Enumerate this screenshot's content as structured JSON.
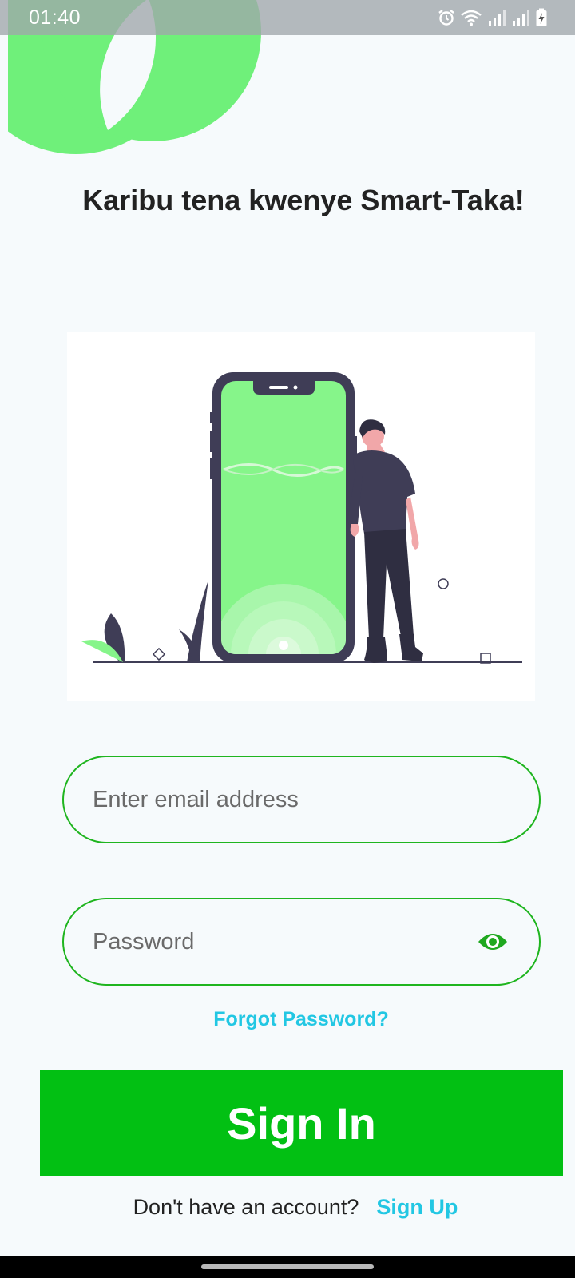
{
  "status_bar": {
    "time": "01:40",
    "icons": [
      "alarm-icon",
      "wifi-icon",
      "signal-icon",
      "signal-icon",
      "battery-charging-icon"
    ]
  },
  "greeting": "Karibu tena kwenye Smart-Taka!",
  "login_form": {
    "email_placeholder": "Enter email address",
    "password_placeholder": "Password",
    "password_visibility_icon": "eye-icon",
    "forgot_password_label": "Forgot Password?",
    "signin_label": "Sign In"
  },
  "signup": {
    "prompt": "Don't have an account?",
    "link_label": "Sign Up"
  },
  "colors": {
    "brand_green": "#02c013",
    "field_border": "#1fb51f",
    "link_cyan": "#22c7e3",
    "deco_green": "#6ff07a",
    "illustration_green": "#86f58a"
  }
}
